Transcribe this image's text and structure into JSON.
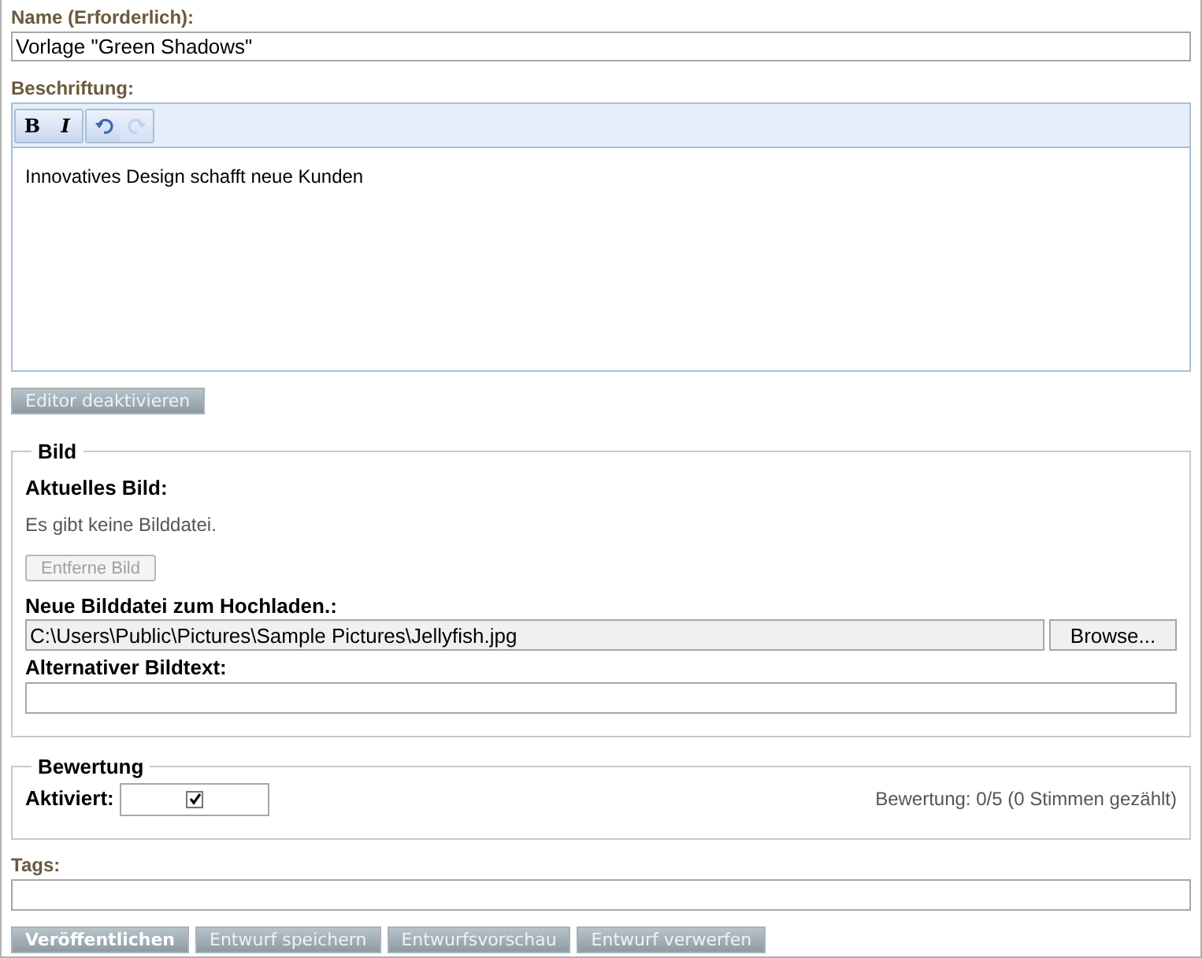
{
  "name_field": {
    "label": "Name (Erforderlich):",
    "value": "Vorlage \"Green Shadows\""
  },
  "caption": {
    "label": "Beschriftung:",
    "toolbar": [
      {
        "kind": "bold",
        "text": "B",
        "disabled": false
      },
      {
        "kind": "italic",
        "text": "I",
        "disabled": false
      },
      {
        "kind": "undo",
        "disabled": false
      },
      {
        "kind": "redo",
        "disabled": true
      }
    ],
    "content": "Innovatives Design schafft neue Kunden",
    "toggle_button": "Editor deaktivieren"
  },
  "image": {
    "legend": "Bild",
    "current_label": "Aktuelles Bild:",
    "current_text": "Es gibt keine Bilddatei.",
    "remove_button": {
      "label": "Entferne Bild",
      "disabled": true
    },
    "upload_label": "Neue Bilddatei zum Hochladen.:",
    "upload_value": "C:\\Users\\Public\\Pictures\\Sample Pictures\\Jellyfish.jpg",
    "browse_button": "Browse...",
    "alt_label": "Alternativer Bildtext:"
  },
  "rating": {
    "legend": "Bewertung",
    "enabled_label": "Aktiviert:",
    "enabled": true,
    "summary": "Bewertung: 0/5 (0 Stimmen gezählt)"
  },
  "tags": {
    "label": "Tags:"
  },
  "actions": [
    {
      "label": "Veröffentlichen",
      "primary": true
    },
    {
      "label": "Entwurf speichern",
      "primary": false
    },
    {
      "label": "Entwurfsvorschau",
      "primary": false
    },
    {
      "label": "Entwurf verwerfen",
      "primary": false
    }
  ]
}
